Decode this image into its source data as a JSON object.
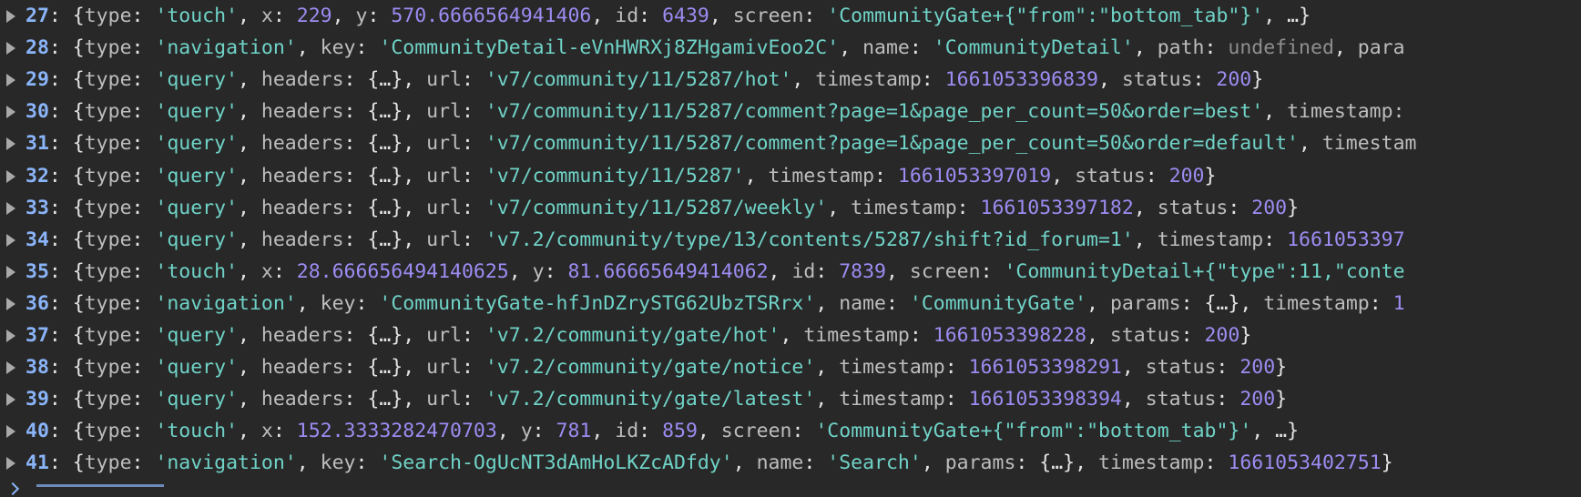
{
  "colors": {
    "background": "#282828",
    "index": "#8ab4f8",
    "punctuation": "#e3e3e3",
    "key": "#bdbdbd",
    "string": "#6fd3c7",
    "number": "#9d8cf2",
    "undefined": "#8f8f8f"
  },
  "icons": {
    "row_toggle": "expand-triangle-icon",
    "prompt": "prompt-chevron-icon"
  },
  "log_entries": [
    {
      "index": "27",
      "tokens": [
        {
          "t": "{",
          "c": "pun"
        },
        {
          "t": "type",
          "c": "key"
        },
        {
          "t": ": ",
          "c": "pun"
        },
        {
          "t": "'touch'",
          "c": "str"
        },
        {
          "t": ", ",
          "c": "pun"
        },
        {
          "t": "x",
          "c": "key"
        },
        {
          "t": ": ",
          "c": "pun"
        },
        {
          "t": "229",
          "c": "num"
        },
        {
          "t": ", ",
          "c": "pun"
        },
        {
          "t": "y",
          "c": "key"
        },
        {
          "t": ": ",
          "c": "pun"
        },
        {
          "t": "570.6666564941406",
          "c": "num"
        },
        {
          "t": ", ",
          "c": "pun"
        },
        {
          "t": "id",
          "c": "key"
        },
        {
          "t": ": ",
          "c": "pun"
        },
        {
          "t": "6439",
          "c": "num"
        },
        {
          "t": ", ",
          "c": "pun"
        },
        {
          "t": "screen",
          "c": "key"
        },
        {
          "t": ": ",
          "c": "pun"
        },
        {
          "t": "'CommunityGate+{\"from\":\"bottom_tab\"}'",
          "c": "str"
        },
        {
          "t": ", …}",
          "c": "pun"
        }
      ]
    },
    {
      "index": "28",
      "tokens": [
        {
          "t": "{",
          "c": "pun"
        },
        {
          "t": "type",
          "c": "key"
        },
        {
          "t": ": ",
          "c": "pun"
        },
        {
          "t": "'navigation'",
          "c": "str"
        },
        {
          "t": ", ",
          "c": "pun"
        },
        {
          "t": "key",
          "c": "key"
        },
        {
          "t": ": ",
          "c": "pun"
        },
        {
          "t": "'CommunityDetail-eVnHWRXj8ZHgamivEoo2C'",
          "c": "str"
        },
        {
          "t": ", ",
          "c": "pun"
        },
        {
          "t": "name",
          "c": "key"
        },
        {
          "t": ": ",
          "c": "pun"
        },
        {
          "t": "'CommunityDetail'",
          "c": "str"
        },
        {
          "t": ", ",
          "c": "pun"
        },
        {
          "t": "path",
          "c": "key"
        },
        {
          "t": ": ",
          "c": "pun"
        },
        {
          "t": "undefined",
          "c": "undef"
        },
        {
          "t": ", ",
          "c": "pun"
        },
        {
          "t": "para",
          "c": "key"
        }
      ]
    },
    {
      "index": "29",
      "tokens": [
        {
          "t": "{",
          "c": "pun"
        },
        {
          "t": "type",
          "c": "key"
        },
        {
          "t": ": ",
          "c": "pun"
        },
        {
          "t": "'query'",
          "c": "str"
        },
        {
          "t": ", ",
          "c": "pun"
        },
        {
          "t": "headers",
          "c": "key"
        },
        {
          "t": ": {…}, ",
          "c": "pun"
        },
        {
          "t": "url",
          "c": "key"
        },
        {
          "t": ": ",
          "c": "pun"
        },
        {
          "t": "'v7/community/11/5287/hot'",
          "c": "str"
        },
        {
          "t": ", ",
          "c": "pun"
        },
        {
          "t": "timestamp",
          "c": "key"
        },
        {
          "t": ": ",
          "c": "pun"
        },
        {
          "t": "1661053396839",
          "c": "num"
        },
        {
          "t": ", ",
          "c": "pun"
        },
        {
          "t": "status",
          "c": "key"
        },
        {
          "t": ": ",
          "c": "pun"
        },
        {
          "t": "200",
          "c": "num"
        },
        {
          "t": "}",
          "c": "pun"
        }
      ]
    },
    {
      "index": "30",
      "tokens": [
        {
          "t": "{",
          "c": "pun"
        },
        {
          "t": "type",
          "c": "key"
        },
        {
          "t": ": ",
          "c": "pun"
        },
        {
          "t": "'query'",
          "c": "str"
        },
        {
          "t": ", ",
          "c": "pun"
        },
        {
          "t": "headers",
          "c": "key"
        },
        {
          "t": ": {…}, ",
          "c": "pun"
        },
        {
          "t": "url",
          "c": "key"
        },
        {
          "t": ": ",
          "c": "pun"
        },
        {
          "t": "'v7/community/11/5287/comment?page=1&page_per_count=50&order=best'",
          "c": "str"
        },
        {
          "t": ", ",
          "c": "pun"
        },
        {
          "t": "timestamp:",
          "c": "key"
        }
      ]
    },
    {
      "index": "31",
      "tokens": [
        {
          "t": "{",
          "c": "pun"
        },
        {
          "t": "type",
          "c": "key"
        },
        {
          "t": ": ",
          "c": "pun"
        },
        {
          "t": "'query'",
          "c": "str"
        },
        {
          "t": ", ",
          "c": "pun"
        },
        {
          "t": "headers",
          "c": "key"
        },
        {
          "t": ": {…}, ",
          "c": "pun"
        },
        {
          "t": "url",
          "c": "key"
        },
        {
          "t": ": ",
          "c": "pun"
        },
        {
          "t": "'v7/community/11/5287/comment?page=1&page_per_count=50&order=default'",
          "c": "str"
        },
        {
          "t": ", ",
          "c": "pun"
        },
        {
          "t": "timestam",
          "c": "key"
        }
      ]
    },
    {
      "index": "32",
      "tokens": [
        {
          "t": "{",
          "c": "pun"
        },
        {
          "t": "type",
          "c": "key"
        },
        {
          "t": ": ",
          "c": "pun"
        },
        {
          "t": "'query'",
          "c": "str"
        },
        {
          "t": ", ",
          "c": "pun"
        },
        {
          "t": "headers",
          "c": "key"
        },
        {
          "t": ": {…}, ",
          "c": "pun"
        },
        {
          "t": "url",
          "c": "key"
        },
        {
          "t": ": ",
          "c": "pun"
        },
        {
          "t": "'v7/community/11/5287'",
          "c": "str"
        },
        {
          "t": ", ",
          "c": "pun"
        },
        {
          "t": "timestamp",
          "c": "key"
        },
        {
          "t": ": ",
          "c": "pun"
        },
        {
          "t": "1661053397019",
          "c": "num"
        },
        {
          "t": ", ",
          "c": "pun"
        },
        {
          "t": "status",
          "c": "key"
        },
        {
          "t": ": ",
          "c": "pun"
        },
        {
          "t": "200",
          "c": "num"
        },
        {
          "t": "}",
          "c": "pun"
        }
      ]
    },
    {
      "index": "33",
      "tokens": [
        {
          "t": "{",
          "c": "pun"
        },
        {
          "t": "type",
          "c": "key"
        },
        {
          "t": ": ",
          "c": "pun"
        },
        {
          "t": "'query'",
          "c": "str"
        },
        {
          "t": ", ",
          "c": "pun"
        },
        {
          "t": "headers",
          "c": "key"
        },
        {
          "t": ": {…}, ",
          "c": "pun"
        },
        {
          "t": "url",
          "c": "key"
        },
        {
          "t": ": ",
          "c": "pun"
        },
        {
          "t": "'v7/community/11/5287/weekly'",
          "c": "str"
        },
        {
          "t": ", ",
          "c": "pun"
        },
        {
          "t": "timestamp",
          "c": "key"
        },
        {
          "t": ": ",
          "c": "pun"
        },
        {
          "t": "1661053397182",
          "c": "num"
        },
        {
          "t": ", ",
          "c": "pun"
        },
        {
          "t": "status",
          "c": "key"
        },
        {
          "t": ": ",
          "c": "pun"
        },
        {
          "t": "200",
          "c": "num"
        },
        {
          "t": "}",
          "c": "pun"
        }
      ]
    },
    {
      "index": "34",
      "tokens": [
        {
          "t": "{",
          "c": "pun"
        },
        {
          "t": "type",
          "c": "key"
        },
        {
          "t": ": ",
          "c": "pun"
        },
        {
          "t": "'query'",
          "c": "str"
        },
        {
          "t": ", ",
          "c": "pun"
        },
        {
          "t": "headers",
          "c": "key"
        },
        {
          "t": ": {…}, ",
          "c": "pun"
        },
        {
          "t": "url",
          "c": "key"
        },
        {
          "t": ": ",
          "c": "pun"
        },
        {
          "t": "'v7.2/community/type/13/contents/5287/shift?id_forum=1'",
          "c": "str"
        },
        {
          "t": ", ",
          "c": "pun"
        },
        {
          "t": "timestamp",
          "c": "key"
        },
        {
          "t": ": ",
          "c": "pun"
        },
        {
          "t": "1661053397",
          "c": "num"
        }
      ]
    },
    {
      "index": "35",
      "tokens": [
        {
          "t": "{",
          "c": "pun"
        },
        {
          "t": "type",
          "c": "key"
        },
        {
          "t": ": ",
          "c": "pun"
        },
        {
          "t": "'touch'",
          "c": "str"
        },
        {
          "t": ", ",
          "c": "pun"
        },
        {
          "t": "x",
          "c": "key"
        },
        {
          "t": ": ",
          "c": "pun"
        },
        {
          "t": "28.666656494140625",
          "c": "num"
        },
        {
          "t": ", ",
          "c": "pun"
        },
        {
          "t": "y",
          "c": "key"
        },
        {
          "t": ": ",
          "c": "pun"
        },
        {
          "t": "81.66665649414062",
          "c": "num"
        },
        {
          "t": ", ",
          "c": "pun"
        },
        {
          "t": "id",
          "c": "key"
        },
        {
          "t": ": ",
          "c": "pun"
        },
        {
          "t": "7839",
          "c": "num"
        },
        {
          "t": ", ",
          "c": "pun"
        },
        {
          "t": "screen",
          "c": "key"
        },
        {
          "t": ": ",
          "c": "pun"
        },
        {
          "t": "'CommunityDetail+{\"type\":11,\"conte",
          "c": "str"
        }
      ]
    },
    {
      "index": "36",
      "tokens": [
        {
          "t": "{",
          "c": "pun"
        },
        {
          "t": "type",
          "c": "key"
        },
        {
          "t": ": ",
          "c": "pun"
        },
        {
          "t": "'navigation'",
          "c": "str"
        },
        {
          "t": ", ",
          "c": "pun"
        },
        {
          "t": "key",
          "c": "key"
        },
        {
          "t": ": ",
          "c": "pun"
        },
        {
          "t": "'CommunityGate-hfJnDZrySTG62UbzTSRrx'",
          "c": "str"
        },
        {
          "t": ", ",
          "c": "pun"
        },
        {
          "t": "name",
          "c": "key"
        },
        {
          "t": ": ",
          "c": "pun"
        },
        {
          "t": "'CommunityGate'",
          "c": "str"
        },
        {
          "t": ", ",
          "c": "pun"
        },
        {
          "t": "params",
          "c": "key"
        },
        {
          "t": ": {…}, ",
          "c": "pun"
        },
        {
          "t": "timestamp",
          "c": "key"
        },
        {
          "t": ": ",
          "c": "pun"
        },
        {
          "t": "1",
          "c": "num"
        }
      ]
    },
    {
      "index": "37",
      "tokens": [
        {
          "t": "{",
          "c": "pun"
        },
        {
          "t": "type",
          "c": "key"
        },
        {
          "t": ": ",
          "c": "pun"
        },
        {
          "t": "'query'",
          "c": "str"
        },
        {
          "t": ", ",
          "c": "pun"
        },
        {
          "t": "headers",
          "c": "key"
        },
        {
          "t": ": {…}, ",
          "c": "pun"
        },
        {
          "t": "url",
          "c": "key"
        },
        {
          "t": ": ",
          "c": "pun"
        },
        {
          "t": "'v7.2/community/gate/hot'",
          "c": "str"
        },
        {
          "t": ", ",
          "c": "pun"
        },
        {
          "t": "timestamp",
          "c": "key"
        },
        {
          "t": ": ",
          "c": "pun"
        },
        {
          "t": "1661053398228",
          "c": "num"
        },
        {
          "t": ", ",
          "c": "pun"
        },
        {
          "t": "status",
          "c": "key"
        },
        {
          "t": ": ",
          "c": "pun"
        },
        {
          "t": "200",
          "c": "num"
        },
        {
          "t": "}",
          "c": "pun"
        }
      ]
    },
    {
      "index": "38",
      "tokens": [
        {
          "t": "{",
          "c": "pun"
        },
        {
          "t": "type",
          "c": "key"
        },
        {
          "t": ": ",
          "c": "pun"
        },
        {
          "t": "'query'",
          "c": "str"
        },
        {
          "t": ", ",
          "c": "pun"
        },
        {
          "t": "headers",
          "c": "key"
        },
        {
          "t": ": {…}, ",
          "c": "pun"
        },
        {
          "t": "url",
          "c": "key"
        },
        {
          "t": ": ",
          "c": "pun"
        },
        {
          "t": "'v7.2/community/gate/notice'",
          "c": "str"
        },
        {
          "t": ", ",
          "c": "pun"
        },
        {
          "t": "timestamp",
          "c": "key"
        },
        {
          "t": ": ",
          "c": "pun"
        },
        {
          "t": "1661053398291",
          "c": "num"
        },
        {
          "t": ", ",
          "c": "pun"
        },
        {
          "t": "status",
          "c": "key"
        },
        {
          "t": ": ",
          "c": "pun"
        },
        {
          "t": "200",
          "c": "num"
        },
        {
          "t": "}",
          "c": "pun"
        }
      ]
    },
    {
      "index": "39",
      "tokens": [
        {
          "t": "{",
          "c": "pun"
        },
        {
          "t": "type",
          "c": "key"
        },
        {
          "t": ": ",
          "c": "pun"
        },
        {
          "t": "'query'",
          "c": "str"
        },
        {
          "t": ", ",
          "c": "pun"
        },
        {
          "t": "headers",
          "c": "key"
        },
        {
          "t": ": {…}, ",
          "c": "pun"
        },
        {
          "t": "url",
          "c": "key"
        },
        {
          "t": ": ",
          "c": "pun"
        },
        {
          "t": "'v7.2/community/gate/latest'",
          "c": "str"
        },
        {
          "t": ", ",
          "c": "pun"
        },
        {
          "t": "timestamp",
          "c": "key"
        },
        {
          "t": ": ",
          "c": "pun"
        },
        {
          "t": "1661053398394",
          "c": "num"
        },
        {
          "t": ", ",
          "c": "pun"
        },
        {
          "t": "status",
          "c": "key"
        },
        {
          "t": ": ",
          "c": "pun"
        },
        {
          "t": "200",
          "c": "num"
        },
        {
          "t": "}",
          "c": "pun"
        }
      ]
    },
    {
      "index": "40",
      "tokens": [
        {
          "t": "{",
          "c": "pun"
        },
        {
          "t": "type",
          "c": "key"
        },
        {
          "t": ": ",
          "c": "pun"
        },
        {
          "t": "'touch'",
          "c": "str"
        },
        {
          "t": ", ",
          "c": "pun"
        },
        {
          "t": "x",
          "c": "key"
        },
        {
          "t": ": ",
          "c": "pun"
        },
        {
          "t": "152.3333282470703",
          "c": "num"
        },
        {
          "t": ", ",
          "c": "pun"
        },
        {
          "t": "y",
          "c": "key"
        },
        {
          "t": ": ",
          "c": "pun"
        },
        {
          "t": "781",
          "c": "num"
        },
        {
          "t": ", ",
          "c": "pun"
        },
        {
          "t": "id",
          "c": "key"
        },
        {
          "t": ": ",
          "c": "pun"
        },
        {
          "t": "859",
          "c": "num"
        },
        {
          "t": ", ",
          "c": "pun"
        },
        {
          "t": "screen",
          "c": "key"
        },
        {
          "t": ": ",
          "c": "pun"
        },
        {
          "t": "'CommunityGate+{\"from\":\"bottom_tab\"}'",
          "c": "str"
        },
        {
          "t": ", …}",
          "c": "pun"
        }
      ]
    },
    {
      "index": "41",
      "tokens": [
        {
          "t": "{",
          "c": "pun"
        },
        {
          "t": "type",
          "c": "key"
        },
        {
          "t": ": ",
          "c": "pun"
        },
        {
          "t": "'navigation'",
          "c": "str"
        },
        {
          "t": ", ",
          "c": "pun"
        },
        {
          "t": "key",
          "c": "key"
        },
        {
          "t": ": ",
          "c": "pun"
        },
        {
          "t": "'Search-OgUcNT3dAmHoLKZcADfdy'",
          "c": "str"
        },
        {
          "t": ", ",
          "c": "pun"
        },
        {
          "t": "name",
          "c": "key"
        },
        {
          "t": ": ",
          "c": "pun"
        },
        {
          "t": "'Search'",
          "c": "str"
        },
        {
          "t": ", ",
          "c": "pun"
        },
        {
          "t": "params",
          "c": "key"
        },
        {
          "t": ": {…}, ",
          "c": "pun"
        },
        {
          "t": "timestamp",
          "c": "key"
        },
        {
          "t": ": ",
          "c": "pun"
        },
        {
          "t": "1661053402751",
          "c": "num"
        },
        {
          "t": "}",
          "c": "pun"
        }
      ]
    }
  ]
}
